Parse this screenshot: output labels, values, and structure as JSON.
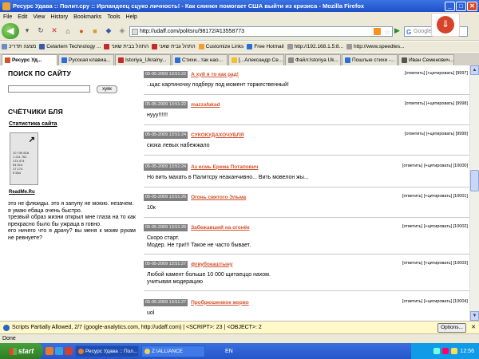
{
  "window": {
    "title": "Ресурс Удава :: Полит.сру :: Ирландеец сцуко личность! - Как сяинкн помогает США выйти из кризиса - Mozilla Firefox",
    "min": "_",
    "max": "□",
    "close": "✕"
  },
  "menu": [
    "File",
    "Edit",
    "View",
    "History",
    "Bookmarks",
    "Tools",
    "Help"
  ],
  "nav": {
    "url": "http://udaff.com/politsru/98172/#13558773",
    "search_placeholder": "Google",
    "search_engine": "G"
  },
  "bookmarks": [
    {
      "label": "מצעה תדריכ",
      "color": "#6a8ac8"
    },
    {
      "label": "Celartem Technology ...",
      "color": "#3a5aa8"
    },
    {
      "label": "התהל בבית שאני",
      "color": "#c02c2c"
    },
    {
      "label": "התהל גבית שאני",
      "color": "#c02c2c"
    },
    {
      "label": "Customize Links",
      "color": "#f0a030"
    },
    {
      "label": "Free Hotmail",
      "color": "#2a6ed8"
    },
    {
      "label": "http://192.168.1.5:8...",
      "color": "#999"
    },
    {
      "label": "http://www.speedtes...",
      "color": "#999"
    }
  ],
  "tabs": [
    {
      "label": "Ресурс Уд...",
      "color": "#d2522c",
      "active": true
    },
    {
      "label": "Русская клавиа...",
      "color": "#2a6ed8"
    },
    {
      "label": "Istoriya_Ukrainy...",
      "color": "#c02c2c"
    },
    {
      "label": "Стихи...так нао...",
      "color": "#2a6ed8"
    },
    {
      "label": "[...Александр Се...",
      "color": "#f0c030"
    },
    {
      "label": "Файл:Istoriya Uk...",
      "color": "#888"
    },
    {
      "label": "Пошлые стихи -...",
      "color": "#2a6ed8"
    },
    {
      "label": "Иван Семенович...",
      "color": "#555"
    }
  ],
  "left": {
    "search_title": "ПОИСК ПО САЙТУ",
    "search_button": "хуяк",
    "counters_title": "СЧЁТЧИКИ БЛЯ",
    "stats_link": "Статистика сайта",
    "counter_lines": [
      "10 749 818",
      "1 211 761",
      "174 474",
      "54 514",
      "17 174",
      "5 554"
    ],
    "readme": "ReadMe.Ru",
    "text": "это не флюиды. это я запупу не моюю. незачем.\nя умаю ебаца очень быстро.\nтрезвый образ жизни открыл мне глаза на то как прекрасно было бы ужраца в говно.\nего ничего что я драчу? вы меня к моим рукам не ревнуете?"
  },
  "posts": [
    {
      "date": "05-05-2009 13:51:22",
      "author": "А хуй я то как рад!",
      "text": "..щас картиночку подберу под момент торжественный!",
      "reply": "[ответить]",
      "quote": "[+цитировать]",
      "num": "[9997]"
    },
    {
      "date": "05-05-2009 13:51:22",
      "author": "mazzafakad",
      "text": "нууу!!!!!!",
      "reply": "[ответить]",
      "quote": "[+цитировать]",
      "num": "[9998]"
    },
    {
      "date": "05-05-2009 13:51:24",
      "author": "СУКОКУДАХОЧУБЛЯ",
      "text": "скока левых набежжало",
      "reply": "[ответить]",
      "quote": "[+цитировать]",
      "num": "[9999]"
    },
    {
      "date": "05-05-2009 13:51:24",
      "author": "Аз есмь Ерема Потапович",
      "text": "Но вить махать в Палитсру неаканчивно... Вить мовелон жы...",
      "reply": "[ответить]",
      "quote": "[+цитировать]",
      "num": "[10000]"
    },
    {
      "date": "05-05-2009 13:51:26",
      "author": "Огонь святого Эльма",
      "text": "10к",
      "reply": "[ответить]",
      "quote": "[+цитировать]",
      "num": "[10001]"
    },
    {
      "date": "05-05-2009 13:51:26",
      "author": "Забежавший на огонёк",
      "text": "Скоро старт.\nМодер. Не три!!! Такое не часто бывает.",
      "reply": "[ответить]",
      "quote": "[+цитировать]",
      "num": "[10002]"
    },
    {
      "date": "05-05-2009 13:51:27",
      "author": "фгвубокаштыну",
      "text": "Любой камент больше 10 000  щитаеццо нахом.\nучитывая модерацию",
      "reply": "[ответить]",
      "quote": "[+цитировать]",
      "num": "[10003]"
    },
    {
      "date": "05-05-2009 13:51:27",
      "author": "Пробрюшенвое жорво",
      "text": "uol",
      "reply": "[ответить]",
      "quote": "[+цитировать]",
      "num": "[10004]"
    }
  ],
  "noscript": {
    "text": "Scripts Partially Allowed, 2/7 (google-analytics.com, http://udaff.com) | <SCRIPT>: 23 | <OBJECT>: 2",
    "options": "Options..."
  },
  "status": {
    "text": "Done",
    "right": ""
  },
  "taskbar": {
    "start": "start",
    "tasks": [
      {
        "label": "Ресурс Удава :: Пол...",
        "active": true
      },
      {
        "label": "Z:\\ALLIANCE",
        "active": false
      }
    ],
    "lang": "EN",
    "clock": "12:56"
  }
}
